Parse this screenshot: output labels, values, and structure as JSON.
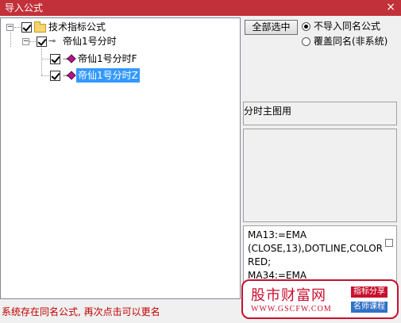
{
  "window": {
    "title": "导入公式",
    "close_glyph": "×"
  },
  "tree": {
    "root": {
      "label": "技术指标公式",
      "expander": "−"
    },
    "group": {
      "label": "帝仙1号分时",
      "expander": "−",
      "icon": "key-icon"
    },
    "items": [
      {
        "label": "帝仙1号分时F",
        "selected": false
      },
      {
        "label": "帝仙1号分时Z",
        "selected": true
      }
    ]
  },
  "controls": {
    "select_all_label": "全部选中",
    "radio_options": [
      {
        "label": "不导入同名公式",
        "checked": true
      },
      {
        "label": "覆盖同名(非系统)",
        "checked": false
      }
    ]
  },
  "info": {
    "usage_text": "分时主图用",
    "code_text": "MA13:=EMA\n(CLOSE,13),DOTLINE,COLOR\nRED;\nMA34:=EMA"
  },
  "status": {
    "message": "系统存在同名公式, 再次点击可以更名"
  },
  "watermark": {
    "site_name": "股市财富网",
    "url": "WWW.GSCFW.COM",
    "tag1": "指标分享",
    "tag2": "名师课程"
  },
  "colors": {
    "titlebar": "#c2313a",
    "selection": "#3399ff",
    "status_text": "#c00000",
    "watermark": "#c8102e"
  }
}
